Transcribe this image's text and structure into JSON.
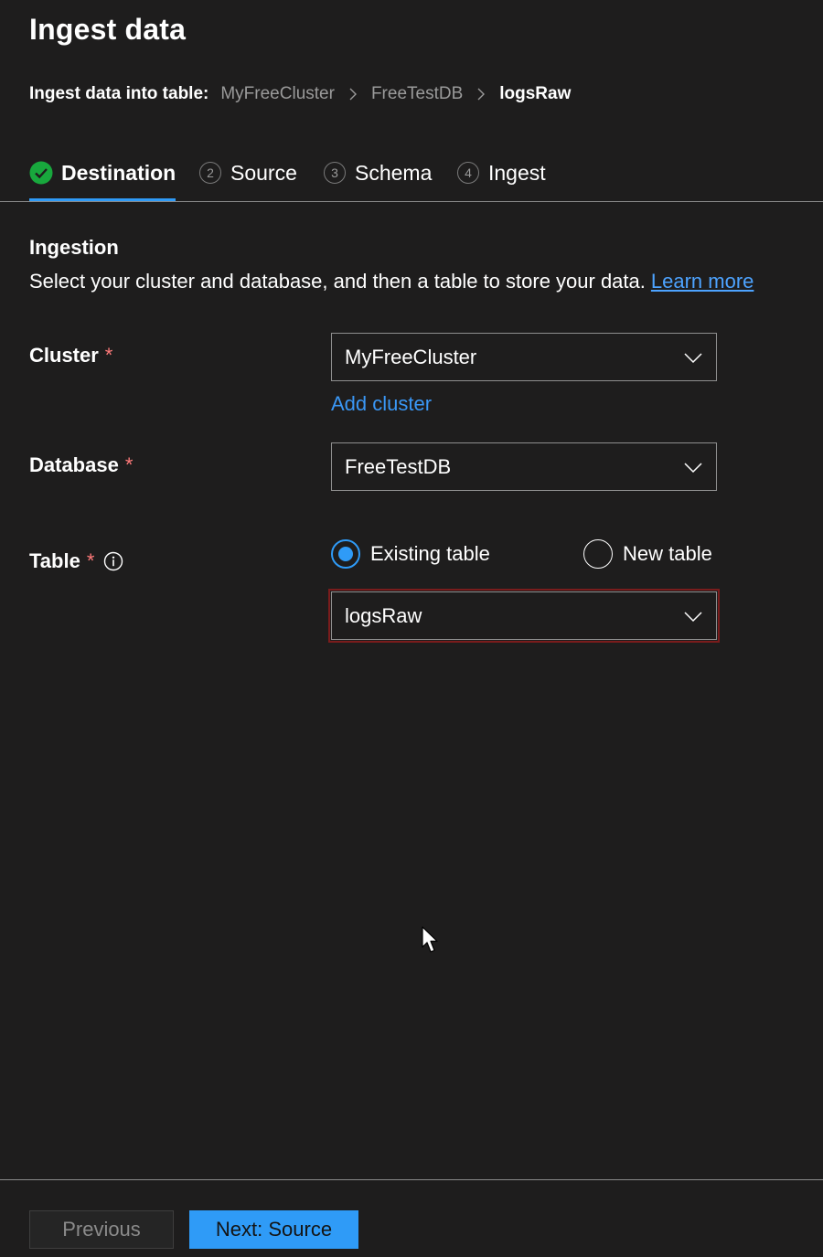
{
  "page": {
    "title": "Ingest data"
  },
  "breadcrumb": {
    "label": "Ingest data into table:",
    "items": [
      "MyFreeCluster",
      "FreeTestDB",
      "logsRaw"
    ]
  },
  "tabs": [
    {
      "label": "Destination",
      "state": "completed",
      "icon": "checkmark-circle-icon"
    },
    {
      "label": "Source",
      "step": "2"
    },
    {
      "label": "Schema",
      "step": "3"
    },
    {
      "label": "Ingest",
      "step": "4"
    }
  ],
  "ingestion": {
    "heading": "Ingestion",
    "description": "Select your cluster and database, and then a table to store your data.",
    "learn_more": "Learn more"
  },
  "fields": {
    "cluster": {
      "label": "Cluster",
      "required": "*",
      "value": "MyFreeCluster",
      "add_link": "Add cluster"
    },
    "database": {
      "label": "Database",
      "required": "*",
      "value": "FreeTestDB"
    },
    "table": {
      "label": "Table",
      "required": "*",
      "info_icon": "info-icon",
      "options": [
        {
          "label": "Existing table",
          "selected": true
        },
        {
          "label": "New table",
          "selected": false
        }
      ],
      "value": "logsRaw"
    }
  },
  "footer": {
    "previous": "Previous",
    "next": "Next: Source"
  },
  "colors": {
    "background": "#1e1d1d",
    "accent": "#2f9bf7",
    "link": "#3a97f5",
    "required": "#ff7a7a",
    "success": "#18a83d",
    "error_outline": "#7a1c1c"
  }
}
